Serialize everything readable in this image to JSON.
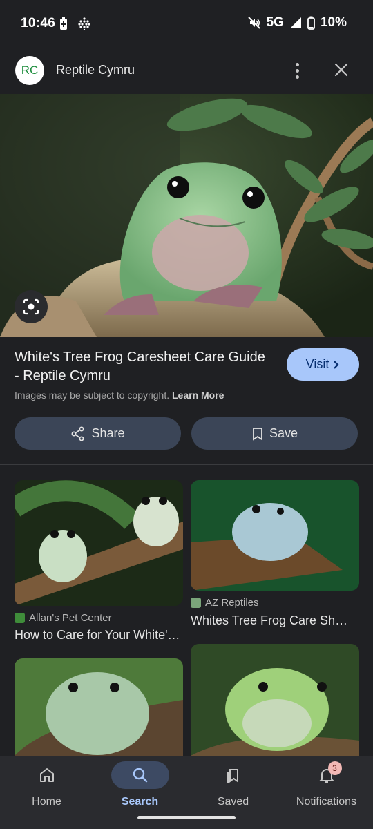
{
  "status": {
    "time": "10:46",
    "network": "5G",
    "battery": "10%"
  },
  "site": {
    "avatar_initials": "RC",
    "name": "Reptile Cymru"
  },
  "result": {
    "title": "White's Tree Frog Caresheet Care Guide - Reptile Cymru",
    "copyright_text": "Images may be subject to copyright.",
    "learn_more": "Learn More",
    "visit_label": "Visit",
    "share_label": "Share",
    "save_label": "Save"
  },
  "related": [
    {
      "source": "Allan's Pet Center",
      "caption": "How to Care for Your White's Tree Frog"
    },
    {
      "source": "AZ Reptiles",
      "caption": "Whites Tree Frog Care Sheet"
    },
    {
      "source": "",
      "caption": ""
    },
    {
      "source": "",
      "caption": ""
    }
  ],
  "nav": {
    "items": [
      {
        "label": "Home",
        "icon": "home-icon"
      },
      {
        "label": "Search",
        "icon": "search-icon",
        "active": true
      },
      {
        "label": "Saved",
        "icon": "saved-icon"
      },
      {
        "label": "Notifications",
        "icon": "bell-icon",
        "badge": "3"
      }
    ]
  },
  "colors": {
    "background": "#1f2023",
    "visit_button": "#a8c7fa",
    "pill_button": "#3b4557",
    "active_nav": "#3d4a63",
    "badge": "#f2b8b5"
  }
}
